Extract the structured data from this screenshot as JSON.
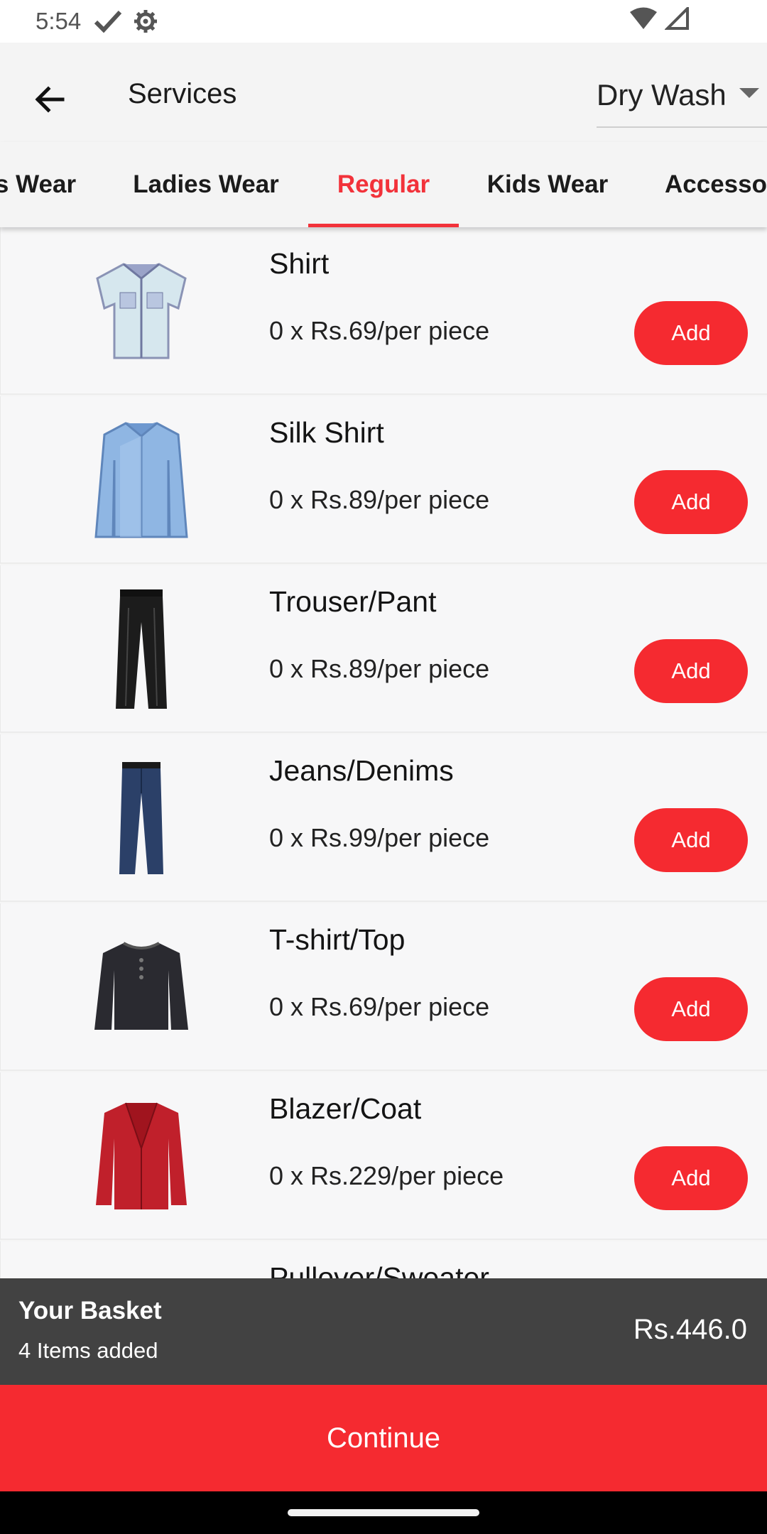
{
  "status_bar": {
    "time": "5:54",
    "icons": [
      "check-icon",
      "settings-gear-icon",
      "wifi-icon",
      "cell-signal-icon"
    ]
  },
  "app_bar": {
    "title": "Services",
    "service_type": "Dry Wash",
    "back_icon": "arrow-left-icon"
  },
  "tabs": [
    {
      "label": "s Wear",
      "active": false
    },
    {
      "label": "Ladies Wear",
      "active": false
    },
    {
      "label": "Regular",
      "active": true
    },
    {
      "label": "Kids Wear",
      "active": false
    },
    {
      "label": "Accesso",
      "active": false
    }
  ],
  "items": [
    {
      "name": "Shirt",
      "price": "0 x Rs.69/per piece",
      "add_label": "Add",
      "icon": "shirt-icon",
      "color": "#cfe3ea"
    },
    {
      "name": "Silk Shirt",
      "price": "0 x Rs.89/per piece",
      "add_label": "Add",
      "icon": "silk-shirt-icon",
      "color": "#8fb6e3"
    },
    {
      "name": "Trouser/Pant",
      "price": "0 x Rs.89/per piece",
      "add_label": "Add",
      "icon": "trouser-icon",
      "color": "#1c1c1c"
    },
    {
      "name": "Jeans/Denims",
      "price": "0 x Rs.99/per piece",
      "add_label": "Add",
      "icon": "jeans-icon",
      "color": "#2b4068"
    },
    {
      "name": "T-shirt/Top",
      "price": "0 x Rs.69/per piece",
      "add_label": "Add",
      "icon": "tshirt-icon",
      "color": "#2a2a30"
    },
    {
      "name": "Blazer/Coat",
      "price": "0 x Rs.229/per piece",
      "add_label": "Add",
      "icon": "blazer-icon",
      "color": "#c0202b"
    },
    {
      "name": "Pullover/Sweater",
      "price": "",
      "add_label": "",
      "icon": "sweater-icon",
      "color": "#7a2a3a"
    }
  ],
  "basket": {
    "title": "Your Basket",
    "count": "4 Items added",
    "total": "Rs.446.0"
  },
  "continue_label": "Continue",
  "colors": {
    "accent": "#f52a30",
    "basket_bg": "#424242",
    "app_bar_bg": "#f4f4f4"
  }
}
